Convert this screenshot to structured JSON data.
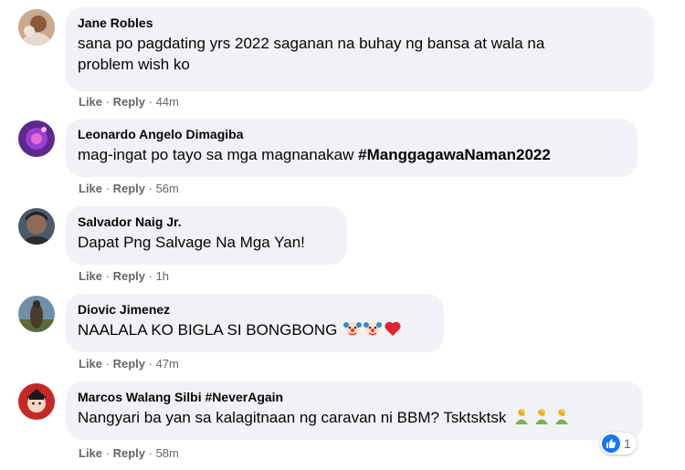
{
  "comments": [
    {
      "author": "Jane Robles",
      "text": "sana po pagdating yrs 2022 saganan na buhay ng bansa at wala na",
      "text_line2": "problem wish ko",
      "like_label": "Like",
      "reply_label": "Reply",
      "time": "44m"
    },
    {
      "author": "Leonardo Angelo Dimagiba",
      "text": "mag-ingat po tayo sa mga magnanakaw ",
      "hashtag": "#ManggagawaNaman2022",
      "like_label": "Like",
      "reply_label": "Reply",
      "time": "56m"
    },
    {
      "author": "Salvador Naig Jr.",
      "text": "Dapat Png Salvage Na Mga Yan!",
      "like_label": "Like",
      "reply_label": "Reply",
      "time": "1h"
    },
    {
      "author": "Diovic Jimenez",
      "text": "NAALALA KO BIGLA SI BONGBONG",
      "emojis": [
        "clown-face-icon",
        "clown-face-icon",
        "red-heart-icon"
      ],
      "like_label": "Like",
      "reply_label": "Reply",
      "time": "47m"
    },
    {
      "author": "Marcos Walang Silbi #NeverAgain",
      "text": "Nangyari ba yan sa kalagitnaan ng caravan ni BBM? Tsktsktsk",
      "emojis": [
        "person-facepalming-icon",
        "person-facepalming-icon",
        "person-facepalming-icon"
      ],
      "like_label": "Like",
      "reply_label": "Reply",
      "time": "58m",
      "reaction": {
        "icon": "like-thumb-icon",
        "count": "1"
      }
    }
  ],
  "separator": "·",
  "colors": {
    "bubble": "#f0f2f5",
    "meta": "#65676b",
    "like_blue": "#1877f2"
  }
}
